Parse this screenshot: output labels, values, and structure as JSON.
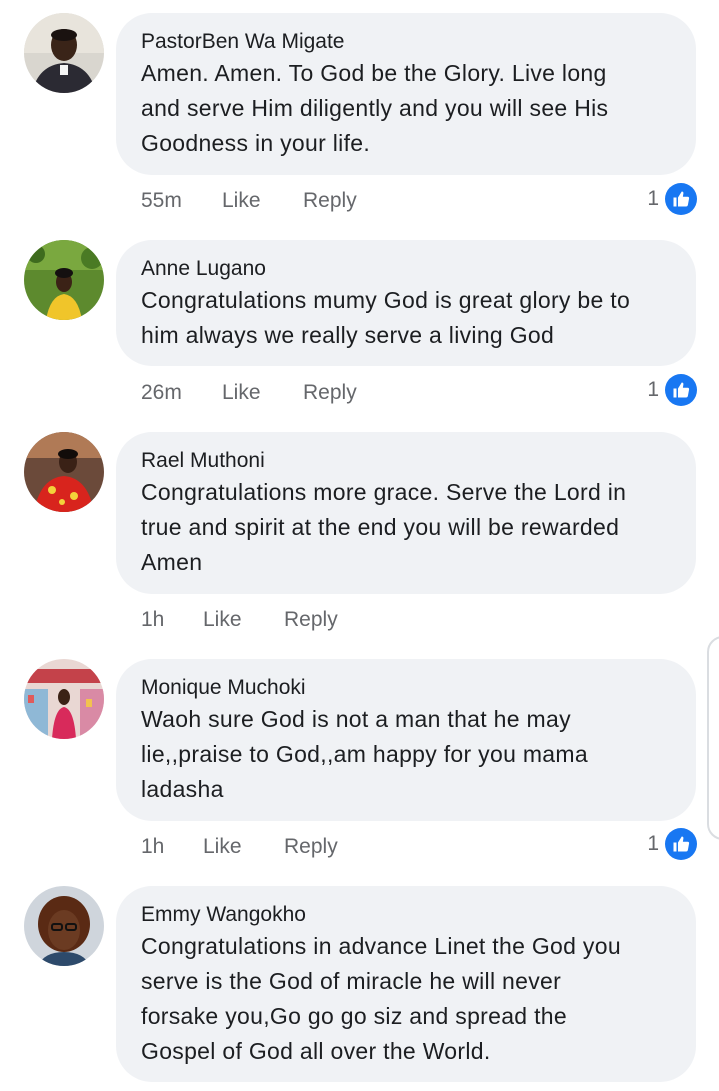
{
  "comments": [
    {
      "author": "PastorBen Wa Migate",
      "lines": [
        "Amen. Amen. To God be the Glory. Live long",
        "and serve Him diligently and you will see His",
        "Goodness in your life."
      ],
      "time": "55m",
      "like": "Like",
      "reply": "Reply",
      "reactions": "1",
      "avatar": "pastor-photo"
    },
    {
      "author": "Anne Lugano",
      "lines": [
        "Congratulations mumy God is great glory be to",
        "him always we really serve a living God"
      ],
      "time": "26m",
      "like": "Like",
      "reply": "Reply",
      "reactions": "1",
      "avatar": "garden-photo"
    },
    {
      "author": "Rael Muthoni",
      "lines": [
        "Congratulations more grace. Serve the Lord in",
        "true and spirit at the end you will be rewarded",
        "Amen"
      ],
      "time": "1h",
      "like": "Like",
      "reply": "Reply",
      "reactions": "",
      "avatar": "red-dress-photo"
    },
    {
      "author": "Monique Muchoki",
      "lines": [
        "Waoh sure God is not a man that he may",
        "lie,,praise to God,,am happy for you mama",
        "ladasha"
      ],
      "time": "1h",
      "like": "Like",
      "reply": "Reply",
      "reactions": "1",
      "avatar": "shop-photo"
    },
    {
      "author": "Emmy Wangokho",
      "lines": [
        "Congratulations in advance Linet the God you",
        "serve is the God of miracle he will never",
        "forsake you,Go go go siz and spread the",
        "Gospel of God all over the World."
      ],
      "avatar": "glasses-photo"
    }
  ],
  "colors": {
    "bubble": "#f0f2f5",
    "like_blue": "#1877f2",
    "meta_gray": "#65676b"
  },
  "icons": {
    "like": "thumbs-up-icon"
  }
}
